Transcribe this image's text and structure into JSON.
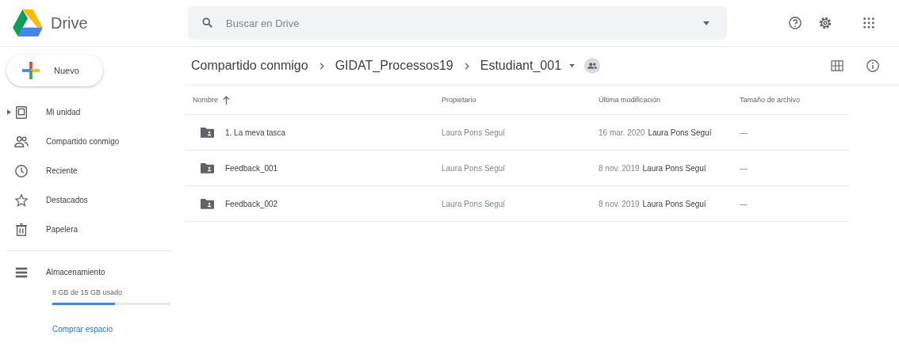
{
  "app": {
    "name": "Drive"
  },
  "search": {
    "placeholder": "Buscar en Drive"
  },
  "new_button": {
    "label": "Nuevo"
  },
  "sidebar": {
    "items": [
      {
        "label": "Mi unidad",
        "expandable": true
      },
      {
        "label": "Compartido conmigo",
        "expandable": false
      },
      {
        "label": "Reciente",
        "expandable": false
      },
      {
        "label": "Destacados",
        "expandable": false
      },
      {
        "label": "Papelera",
        "expandable": false
      }
    ]
  },
  "storage": {
    "label": "Almacenamiento",
    "usage": "8 GB de 15 GB usado",
    "level": 0.53,
    "link": "Comprar espacio"
  },
  "breadcrumb": [
    "Compartido conmigo",
    "GIDAT_Processos19",
    "Estudiant_001"
  ],
  "table": {
    "columns": [
      "Nombre",
      "Propietario",
      "Última modificación",
      "Tamaño de archivo"
    ],
    "rows": [
      {
        "name": "1. La meva tasca",
        "owner": "Laura Pons Seguí",
        "modified_date": "16 mar. 2020",
        "modified_by": "Laura Pons Seguí",
        "size": "—"
      },
      {
        "name": "Feedback_001",
        "owner": "Laura Pons Seguí",
        "modified_date": "8 nov. 2019",
        "modified_by": "Laura Pons Seguí",
        "size": "—"
      },
      {
        "name": "Feedback_002",
        "owner": "Laura Pons Seguí",
        "modified_date": "8 nov. 2019",
        "modified_by": "Laura Pons Seguí",
        "size": "—"
      }
    ]
  }
}
